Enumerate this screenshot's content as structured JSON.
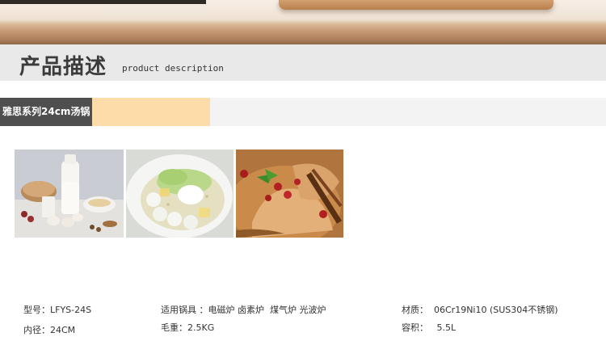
{
  "header": {
    "title_cn": "产品描述",
    "title_en": "product description"
  },
  "product": {
    "name": "雅思系列24cm汤锅"
  },
  "photos": [
    {
      "icon": "milk-bread-food-photo"
    },
    {
      "icon": "bowl-meatballs-food-photo"
    },
    {
      "icon": "braised-duck-food-photo"
    }
  ],
  "specs": {
    "model": "型号：LFYS-24S",
    "diameter": "内径：24CM",
    "stoves": "适用锅具 ：电磁炉 卤素炉  煤气炉 光波炉",
    "weight": "毛重：2.5KG",
    "material": "材质：  06Cr19Ni10 (SUS304不锈钢)",
    "capacity": "容积：   5.5L"
  }
}
